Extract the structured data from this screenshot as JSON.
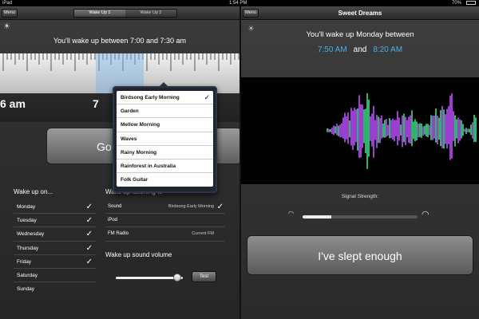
{
  "status_bar": {
    "carrier": "iPad",
    "time": "1:54 PM",
    "battery": "70%"
  },
  "left": {
    "menu_label": "Menu",
    "tabs": [
      {
        "label": "Wake Up 1",
        "active": true
      },
      {
        "label": "Wake Up 2",
        "active": false
      }
    ],
    "wake_range": "You'll wake up between 7:00 and 7:30 am",
    "ruler": {
      "label_left": "6 am",
      "label_mid": "7"
    },
    "goto_label": "Go T",
    "wake_on": {
      "title": "Wake up on...",
      "days": [
        {
          "label": "Monday",
          "checked": true
        },
        {
          "label": "Tuesday",
          "checked": true
        },
        {
          "label": "Wednesday",
          "checked": true
        },
        {
          "label": "Thursday",
          "checked": true
        },
        {
          "label": "Friday",
          "checked": true
        },
        {
          "label": "Saturday",
          "checked": false
        },
        {
          "label": "Sunday",
          "checked": false
        }
      ]
    },
    "options": {
      "title": "Wake up listening to",
      "rows": [
        {
          "label": "Sound",
          "value": "Birdsong Early Morning",
          "checked": true
        },
        {
          "label": "iPod",
          "value": "",
          "checked": false
        },
        {
          "label": "FM Radio",
          "value": "Current FM",
          "checked": false
        }
      ]
    },
    "volume": {
      "title": "Wake up sound volume",
      "level": 0.92,
      "test_label": "Test"
    },
    "popover": {
      "items": [
        {
          "label": "Birdsong Early Morning",
          "selected": true
        },
        {
          "label": "Garden",
          "selected": false
        },
        {
          "label": "Mellow Morning",
          "selected": false
        },
        {
          "label": "Waves",
          "selected": false
        },
        {
          "label": "Rainy Morning",
          "selected": false
        },
        {
          "label": "Rainforest in Australia",
          "selected": false
        },
        {
          "label": "Folk Guitar",
          "selected": false
        }
      ]
    }
  },
  "right": {
    "menu_label": "Menu",
    "title": "Sweet Dreams",
    "wake_day": "You'll wake up Monday between",
    "time_start": "7:50 AM",
    "and_text": "and",
    "time_end": "8:20 AM",
    "signal_label": "Signal Strength:",
    "signal_level": 0.25,
    "slept_label": "I've slept enough",
    "colors": {
      "accent_time": "#4aaee8",
      "wave_green": "#2fb56a",
      "wave_purple": "#9b3fd1"
    }
  }
}
